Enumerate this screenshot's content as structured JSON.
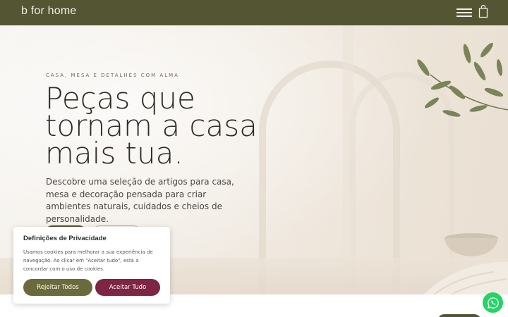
{
  "header": {
    "logo": "b for home",
    "menu_icon": "hamburger-menu-icon",
    "cart_icon": "shopping-bag-icon"
  },
  "hero": {
    "eyebrow": "CASA, MESA E DETALHES COM ALMA",
    "headline": [
      "Peças que",
      "tornam a casa",
      "mais tua."
    ],
    "subtitle": "Descobre uma seleção de artigos para casa, mesa e decoração pensada para criar ambientes naturais, cuidados e cheios de personalidade."
  },
  "cookie": {
    "title": "Definições de Privacidade",
    "text": "Usamos cookies para melhorar a sua experiência de navegação. Ao clicar em \"Aceitar tudo\", está a concordar com o uso de cookies.",
    "reject_label": "Rejeitar Todos",
    "accept_label": "Aceitar Tudo"
  },
  "whatsapp_icon": "whatsapp-icon",
  "colors": {
    "brand": "#545532",
    "accept": "#7d2541",
    "reject": "#6b6a3c",
    "whatsapp": "#25d366"
  }
}
